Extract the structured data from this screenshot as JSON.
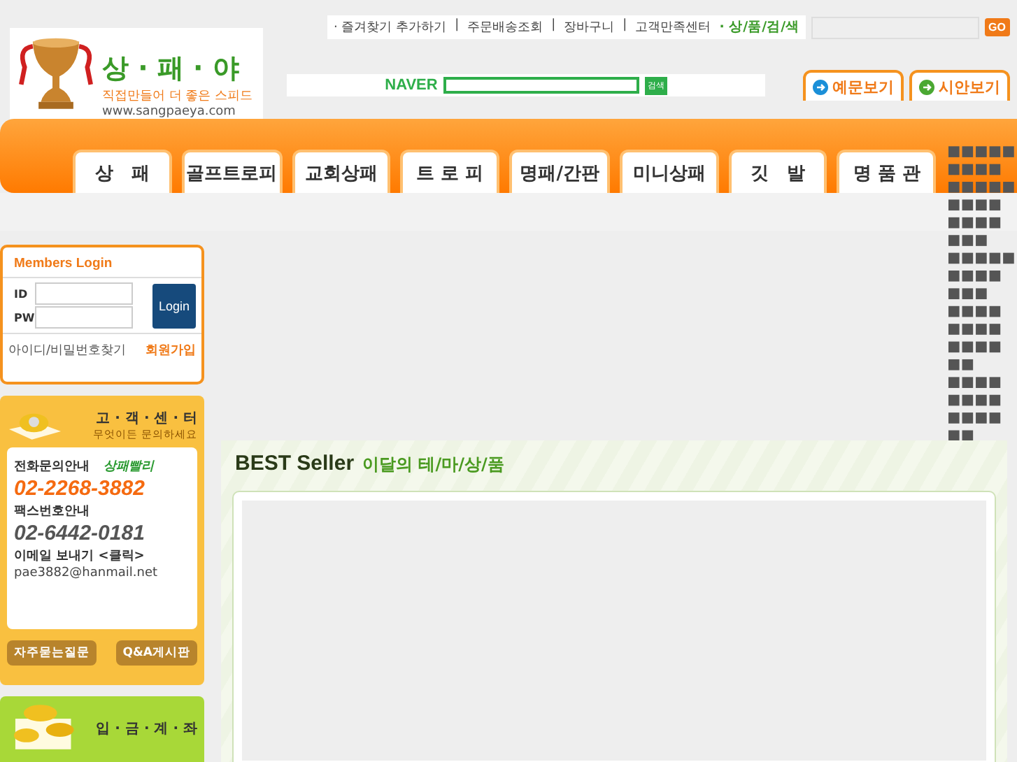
{
  "logo": {
    "name": "상 · 패 · 야",
    "slogan": "직접만들어 더 좋은 스피드",
    "url": "www.sangpaeya.com"
  },
  "top_links": [
    "· 즐겨찾기 추가하기",
    "주문배송조회",
    "장바구니",
    "고객만족센터"
  ],
  "top_link_separator": "|",
  "product_search": {
    "label": "· 상/품/검/색",
    "button": "GO"
  },
  "naver_search": {
    "brand": "NAVER",
    "button": "검색"
  },
  "header_buttons": [
    {
      "label": "예문보기",
      "color": "#1a8fd8"
    },
    {
      "label": "시안보기",
      "color": "#4aa832"
    }
  ],
  "nav_tabs": [
    "상　패",
    "골프트로피",
    "교회상패",
    "트 로 피",
    "명패/간판",
    "미니상패",
    "깃　발",
    "명 품 관"
  ],
  "login": {
    "title": "Members Login",
    "id_label": "ID",
    "pw_label": "PW",
    "button": "Login",
    "find_link": "아이디/비밀번호찾기",
    "join_link": "회원가입"
  },
  "customer_center": {
    "title": "고 · 객 · 센 · 터",
    "subtitle": "무엇이든 문의하세요",
    "phone_label": "전화문의안내",
    "tagline": "상패빨리",
    "phone": "02-2268-3882",
    "fax_label": "팩스번호안내",
    "fax": "02-6442-0181",
    "email_label": "이메일 보내기 <클릭>",
    "email": "pae3882@hanmail.net",
    "buttons": [
      "자주묻는질문",
      "Q&A게시판"
    ]
  },
  "account": {
    "title": "입 · 금 · 계 · 좌"
  },
  "best_seller": {
    "title": "BEST Seller",
    "subtitle": "이달의 테/마/상/품"
  }
}
